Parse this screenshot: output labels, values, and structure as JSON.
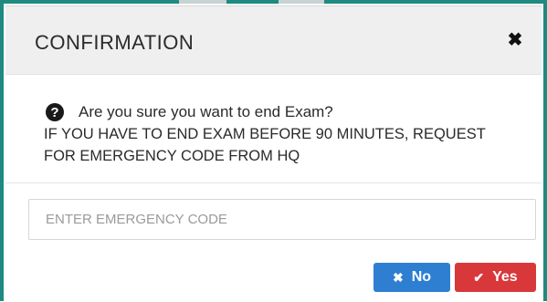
{
  "dialog": {
    "title": "CONFIRMATION",
    "close_icon": "close-icon",
    "question_icon": "question-circle-icon",
    "question": "Are you sure you want to end Exam?",
    "warning_line1": "IF YOU HAVE TO END EXAM BEFORE 90 MINUTES, REQUEST",
    "warning_line2": "FOR EMERGENCY CODE FROM HQ",
    "code_input": {
      "value": "",
      "placeholder": "ENTER EMERGENCY CODE"
    },
    "buttons": {
      "no_label": "No",
      "no_icon": "x-icon",
      "yes_label": "Yes",
      "yes_icon": "check-icon"
    }
  },
  "colors": {
    "accent_teal": "#1f8a80",
    "no_button": "#2e7fd2",
    "yes_button": "#d9383b",
    "header_bg": "#efefef"
  }
}
